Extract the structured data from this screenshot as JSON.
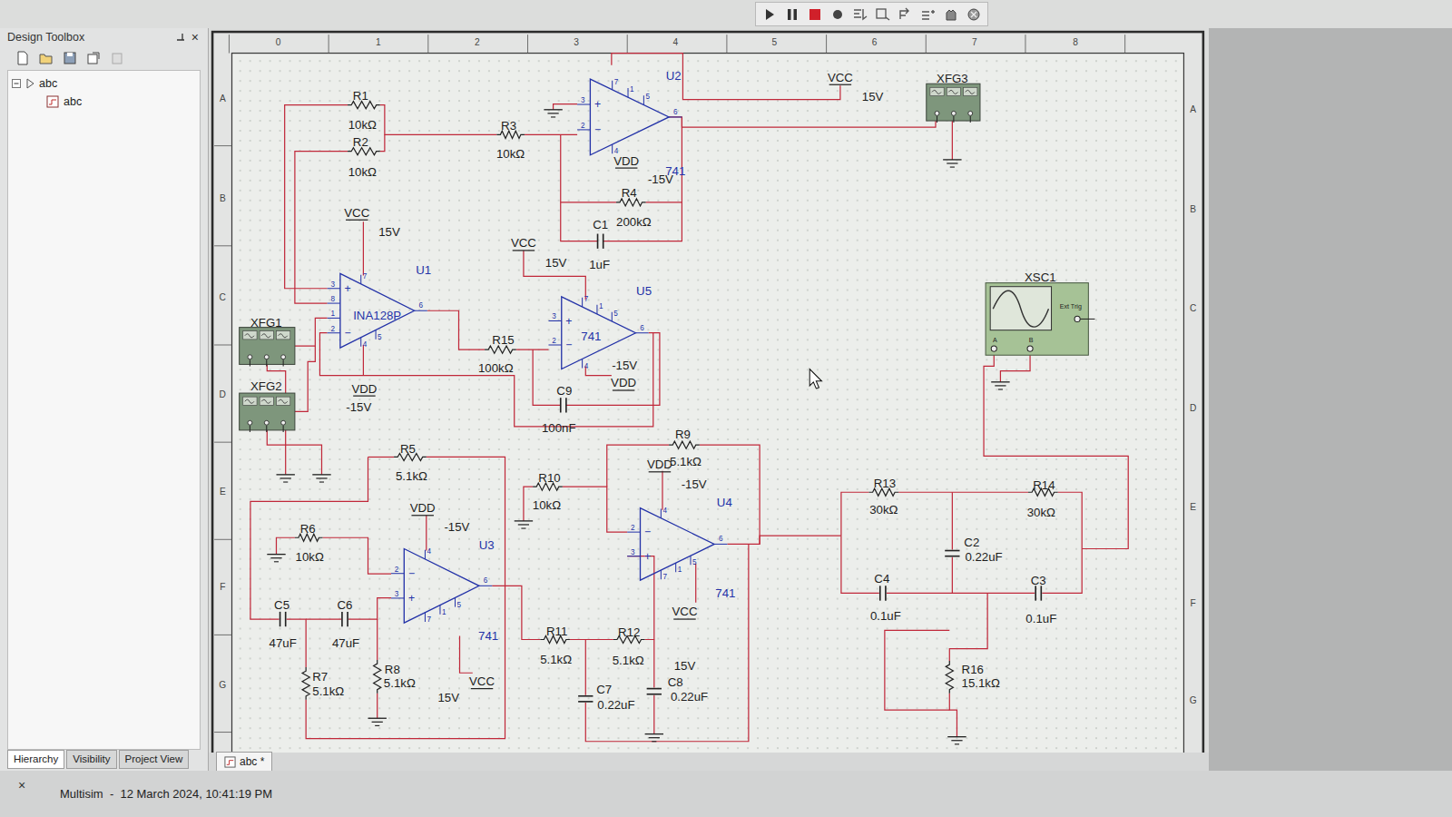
{
  "design_toolbox": {
    "title": "Design Toolbox",
    "close": "×",
    "tree": {
      "label": "abc",
      "expanded": true,
      "children": [
        {
          "label": "abc"
        }
      ]
    },
    "tabs": [
      {
        "label": "Hierarchy",
        "selected": true
      },
      {
        "label": "Visibility",
        "selected": false
      },
      {
        "label": "Project View",
        "selected": false
      }
    ]
  },
  "schematic": {
    "ruler_top": [
      "0",
      "1",
      "2",
      "3",
      "4",
      "5",
      "6",
      "7",
      "8"
    ],
    "ruler_left": [
      "A",
      "B",
      "C",
      "D",
      "E",
      "F",
      "G"
    ],
    "ruler_right": [
      "A",
      "B",
      "C",
      "D",
      "E",
      "F",
      "G"
    ],
    "parts": [
      {
        "kind": "resistor",
        "ref": "R1",
        "value": "10kΩ"
      },
      {
        "kind": "resistor",
        "ref": "R2",
        "value": "10kΩ"
      },
      {
        "kind": "resistor",
        "ref": "R3",
        "value": "10kΩ"
      },
      {
        "kind": "resistor",
        "ref": "R4",
        "value": "200kΩ"
      },
      {
        "kind": "resistor",
        "ref": "R15",
        "value": "100kΩ"
      },
      {
        "kind": "resistor",
        "ref": "R5",
        "value": "5.1kΩ"
      },
      {
        "kind": "resistor",
        "ref": "R6",
        "value": "10kΩ"
      },
      {
        "kind": "resistor",
        "ref": "R9",
        "value": "5.1kΩ"
      },
      {
        "kind": "resistor",
        "ref": "R10",
        "value": "10kΩ"
      },
      {
        "kind": "resistor",
        "ref": "R11",
        "value": "5.1kΩ"
      },
      {
        "kind": "resistor",
        "ref": "R12",
        "value": "5.1kΩ"
      },
      {
        "kind": "resistor",
        "ref": "R13",
        "value": "30kΩ"
      },
      {
        "kind": "resistor",
        "ref": "R14",
        "value": "30kΩ"
      },
      {
        "kind": "resistor",
        "ref": "R7",
        "value": "5.1kΩ"
      },
      {
        "kind": "resistor",
        "ref": "R8",
        "value": "5.1kΩ"
      },
      {
        "kind": "resistor",
        "ref": "R16",
        "value": "15.1kΩ"
      },
      {
        "kind": "capacitor",
        "ref": "C1",
        "value": "1uF"
      },
      {
        "kind": "capacitor",
        "ref": "C9",
        "value": "100nF"
      },
      {
        "kind": "capacitor",
        "ref": "C5",
        "value": "47uF"
      },
      {
        "kind": "capacitor",
        "ref": "C6",
        "value": "47uF"
      },
      {
        "kind": "capacitor",
        "ref": "C2",
        "value": "0.22uF"
      },
      {
        "kind": "capacitor",
        "ref": "C4",
        "value": "0.1uF"
      },
      {
        "kind": "capacitor",
        "ref": "C3",
        "value": "0.1uF"
      },
      {
        "kind": "capacitor",
        "ref": "C7",
        "value": "0.22uF"
      },
      {
        "kind": "capacitor",
        "ref": "C8",
        "value": "0.22uF"
      },
      {
        "kind": "opamp",
        "ref": "U2",
        "model": "741",
        "signs": [
          "+",
          "−"
        ],
        "pins": {
          "inputs": [
            "3",
            "2"
          ],
          "top": [
            "7",
            "1",
            "5"
          ],
          "bottom": [
            "4"
          ],
          "output": "6"
        }
      },
      {
        "kind": "opamp",
        "ref": "U1",
        "model": "INA128P",
        "signs": [
          "+",
          "−"
        ],
        "pins": {
          "inputs": [
            "3",
            "8",
            "1",
            "2"
          ],
          "top": [
            "7"
          ],
          "bottom": [
            "4",
            "5"
          ],
          "output": "6"
        }
      },
      {
        "kind": "opamp",
        "ref": "U5",
        "model": "741",
        "signs": [
          "+",
          "−"
        ],
        "pins": {
          "inputs": [
            "3",
            "2"
          ],
          "top": [
            "7",
            "1",
            "5"
          ],
          "bottom": [
            "4"
          ],
          "output": "6"
        }
      },
      {
        "kind": "opamp",
        "ref": "U3",
        "model": "741",
        "signs": [
          "−",
          "+"
        ],
        "pins": {
          "inputs": [
            "2",
            "3"
          ],
          "top": [
            "4"
          ],
          "bottom": [
            "7",
            "1",
            "5"
          ],
          "output": "6"
        }
      },
      {
        "kind": "opamp",
        "ref": "U4",
        "model": "741",
        "signs": [
          "−",
          "+"
        ],
        "pins": {
          "inputs": [
            "2",
            "3"
          ],
          "top": [
            "4"
          ],
          "bottom": [
            "7",
            "1",
            "5"
          ],
          "output": "6"
        }
      },
      {
        "kind": "power",
        "net": "VCC",
        "voltage": "15V"
      },
      {
        "kind": "power",
        "net": "VDD",
        "voltage": "-15V"
      },
      {
        "kind": "power",
        "net": "VCC",
        "voltage": "15V"
      },
      {
        "kind": "power",
        "net": "VCC",
        "voltage": "15V"
      },
      {
        "kind": "power",
        "net": "VDD",
        "voltage": "-15V"
      },
      {
        "kind": "power",
        "net": "VDD",
        "voltage": "-15V"
      },
      {
        "kind": "power",
        "net": "VDD",
        "voltage": "-15V"
      },
      {
        "kind": "power",
        "net": "VDD",
        "voltage": "-15V"
      },
      {
        "kind": "power",
        "net": "VCC",
        "voltage": "15V"
      },
      {
        "kind": "power",
        "net": "VCC",
        "voltage": "15V"
      },
      {
        "kind": "function-generator",
        "ref": "XFG3"
      },
      {
        "kind": "function-generator",
        "ref": "XFG1"
      },
      {
        "kind": "function-generator",
        "ref": "XFG2"
      },
      {
        "kind": "oscilloscope",
        "ref": "XSC1",
        "trigger": "Ext Trig",
        "channels": [
          "A",
          "B"
        ]
      }
    ]
  },
  "document_tabs": [
    {
      "label": "abc *",
      "selected": true
    }
  ],
  "status_bar": {
    "close": "×",
    "text": "Multisim  -  12 March 2024, 10:41:19 PM"
  }
}
